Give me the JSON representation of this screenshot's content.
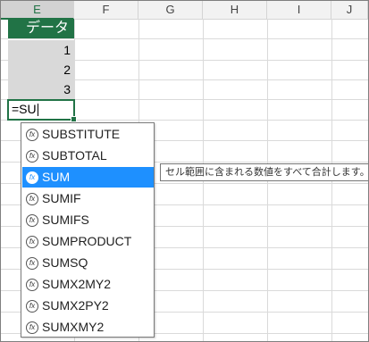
{
  "columns": [
    "E",
    "F",
    "G",
    "H",
    "I",
    "J"
  ],
  "active_column": "E",
  "table": {
    "header": "データ",
    "values": [
      "1",
      "2",
      "3"
    ]
  },
  "edit_cell": {
    "value": "=SU"
  },
  "autocomplete": {
    "icon": "fx-icon",
    "items": [
      "SUBSTITUTE",
      "SUBTOTAL",
      "SUM",
      "SUMIF",
      "SUMIFS",
      "SUMPRODUCT",
      "SUMSQ",
      "SUMX2MY2",
      "SUMX2PY2",
      "SUMXMY2"
    ],
    "selected": "SUM"
  },
  "tooltip": {
    "text": "セル範囲に含まれる数値をすべて合計します。"
  },
  "colors": {
    "accent": "#217346",
    "selection": "#1e90ff",
    "cell_fill": "#d9d9d9"
  }
}
